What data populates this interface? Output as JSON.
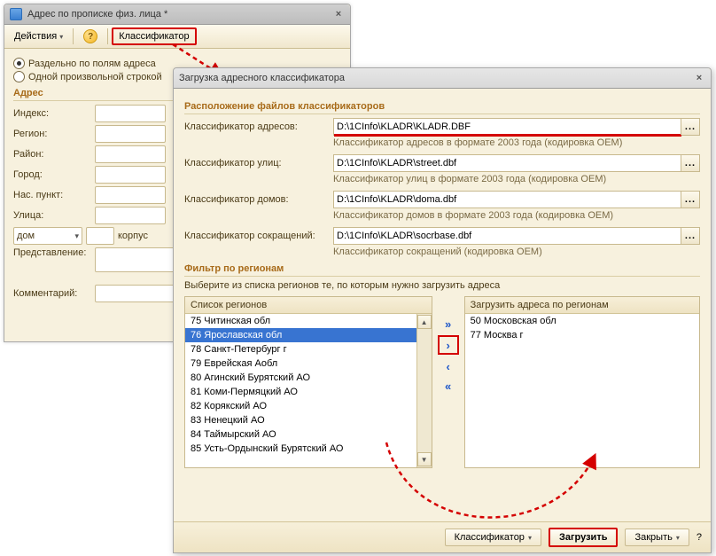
{
  "back": {
    "title": "Адрес по прописке физ. лица *",
    "actions_label": "Действия",
    "classifier_label": "Классификатор",
    "radio_split": "Раздельно по полям адреса",
    "radio_one": "Одной произвольной строкой",
    "section_addr": "Адрес",
    "labels": {
      "index": "Индекс:",
      "region": "Регион:",
      "district": "Район:",
      "city": "Город:",
      "settlement": "Нас. пункт:",
      "street": "Улица:",
      "house_type": "дом",
      "korpus": "корпус",
      "repr": "Представление:",
      "comment": "Комментарий:"
    }
  },
  "dlg": {
    "title": "Загрузка адресного классификатора",
    "section_files": "Расположение файлов классификаторов",
    "rows": {
      "addr_label": "Классификатор адресов:",
      "addr_val": "D:\\1CInfo\\KLADR\\KLADR.DBF",
      "addr_hint": "Классификатор адресов в формате  2003 года  (кодировка ОЕМ)",
      "street_label": "Классификатор улиц:",
      "street_val": "D:\\1CInfo\\KLADR\\street.dbf",
      "street_hint": "Классификатор улиц в формате  2003 года  (кодировка ОЕМ)",
      "house_label": "Классификатор домов:",
      "house_val": "D:\\1CInfo\\KLADR\\doma.dbf",
      "house_hint": "Классификатор домов в формате  2003 года  (кодировка ОЕМ)",
      "abbr_label": "Классификатор сокращений:",
      "abbr_val": "D:\\1CInfo\\KLADR\\socrbase.dbf",
      "abbr_hint": "Классификатор сокращений (кодировка ОЕМ)"
    },
    "section_filter": "Фильтр по регионам",
    "filter_hint": "Выберите из списка регионов те, по которым нужно загрузить адреса",
    "left_head": "Список регионов",
    "right_head": "Загрузить адреса по регионам",
    "left_items": [
      "75 Читинская обл",
      "76 Ярославская обл",
      "78 Санкт-Петербург г",
      "79 Еврейская Аобл",
      "80 Агинский Бурятский АО",
      "81 Коми-Пермяцкий АО",
      "82 Корякский АО",
      "83 Ненецкий АО",
      "84 Таймырский АО",
      "85 Усть-Ордынский Бурятский АО"
    ],
    "left_selected_index": 1,
    "right_items": [
      "50 Московская обл",
      "77 Москва г"
    ],
    "footer": {
      "classifier": "Классификатор",
      "load": "Загрузить",
      "close": "Закрыть"
    }
  }
}
